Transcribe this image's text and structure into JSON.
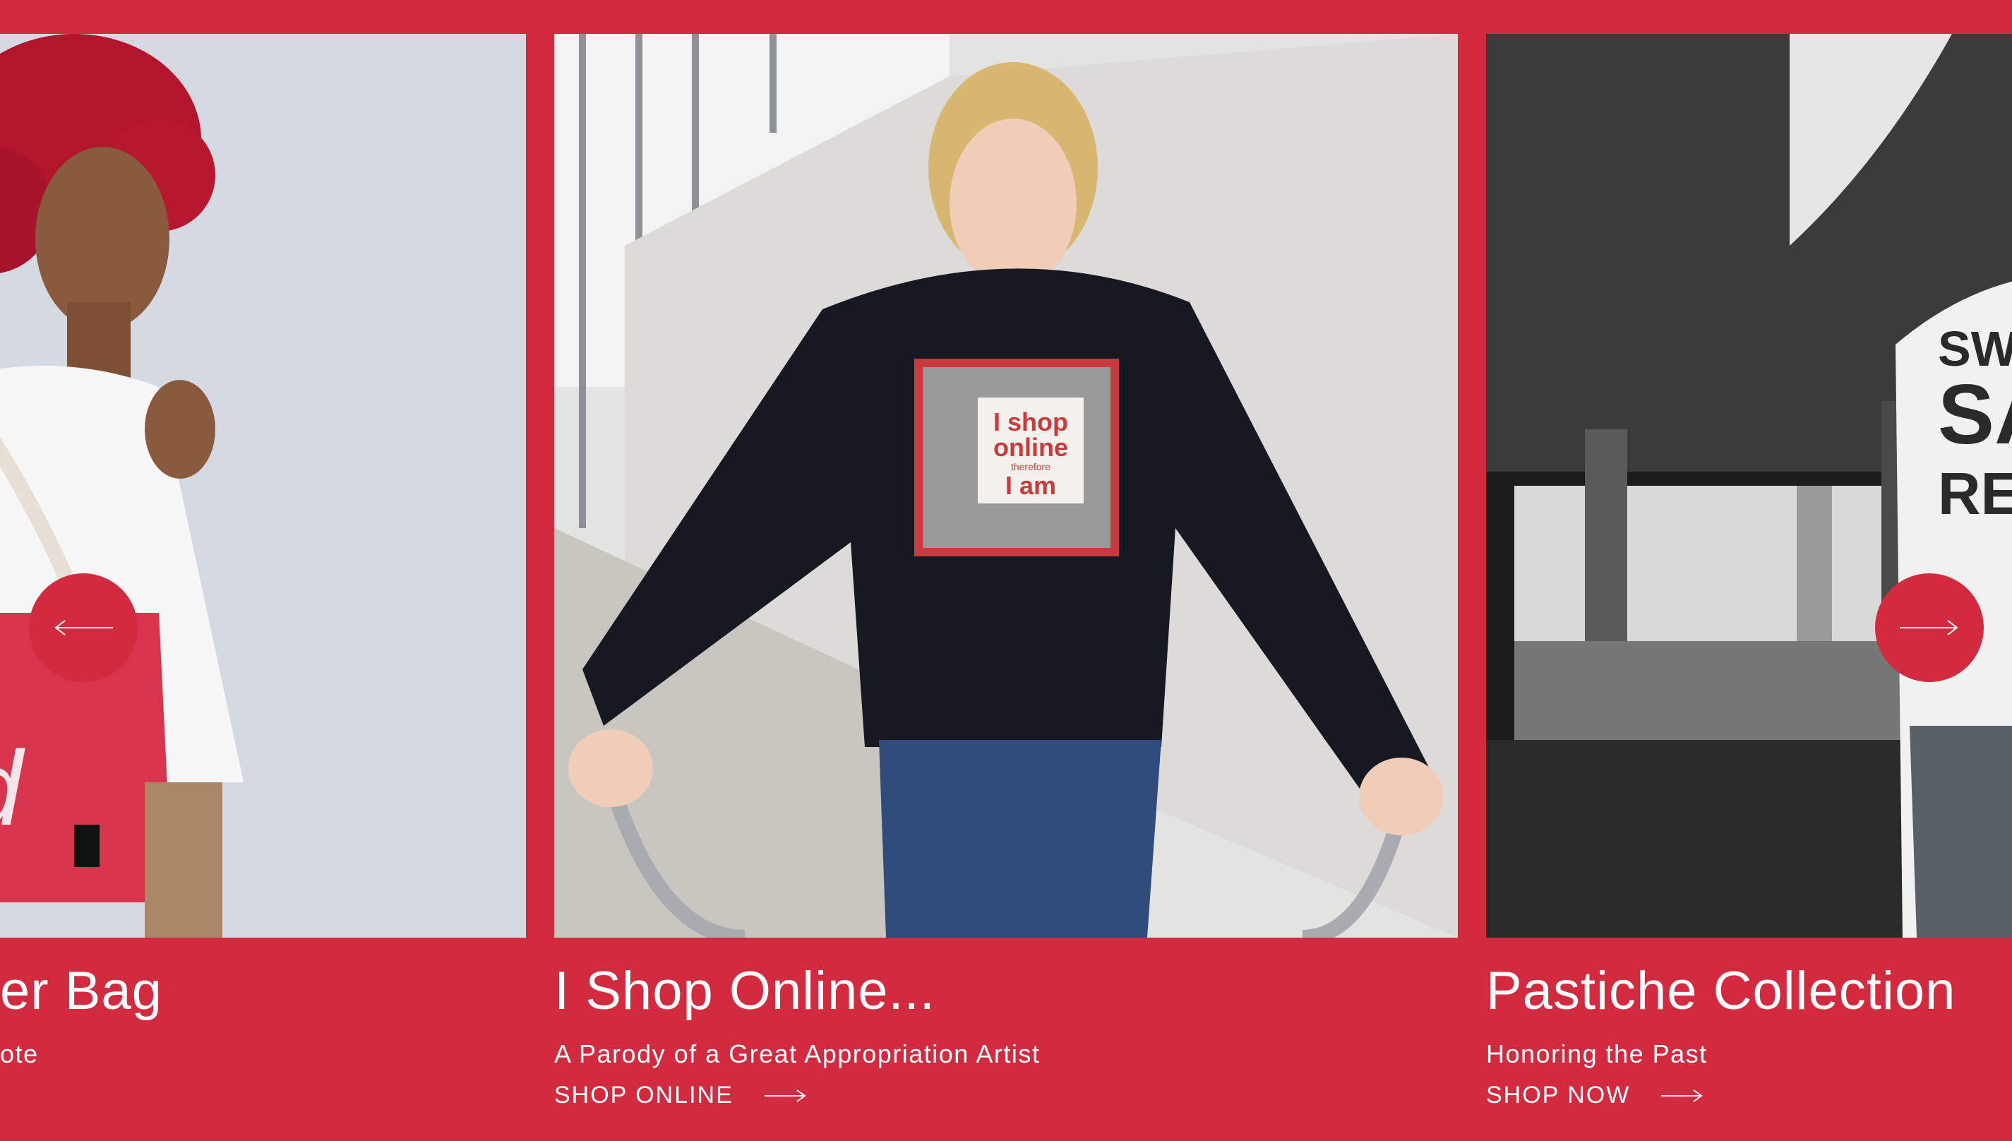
{
  "carousel": {
    "slides": [
      {
        "title": "er Bag",
        "subtitle": "ote",
        "photo_alt": "tote-bag-model-photo"
      },
      {
        "title": "I Shop Online...",
        "subtitle": "A Parody of a Great Appropriation Artist",
        "cta": "SHOP ONLINE",
        "print_text": {
          "line1": "I shop",
          "line2": "online",
          "line3": "therefore",
          "line4": "I am"
        }
      },
      {
        "title": "Pastiche Collection",
        "subtitle": "Honoring the Past",
        "cta": "SHOP NOW",
        "tee_text": {
          "line1": "SWE",
          "line2": "SA",
          "line3": "REFRE"
        }
      }
    ],
    "prev_icon": "arrow-left-icon",
    "next_icon": "arrow-right-icon"
  },
  "tote_print": "ed",
  "colors": {
    "brand_red": "#d22b40",
    "text": "#ffffff"
  }
}
